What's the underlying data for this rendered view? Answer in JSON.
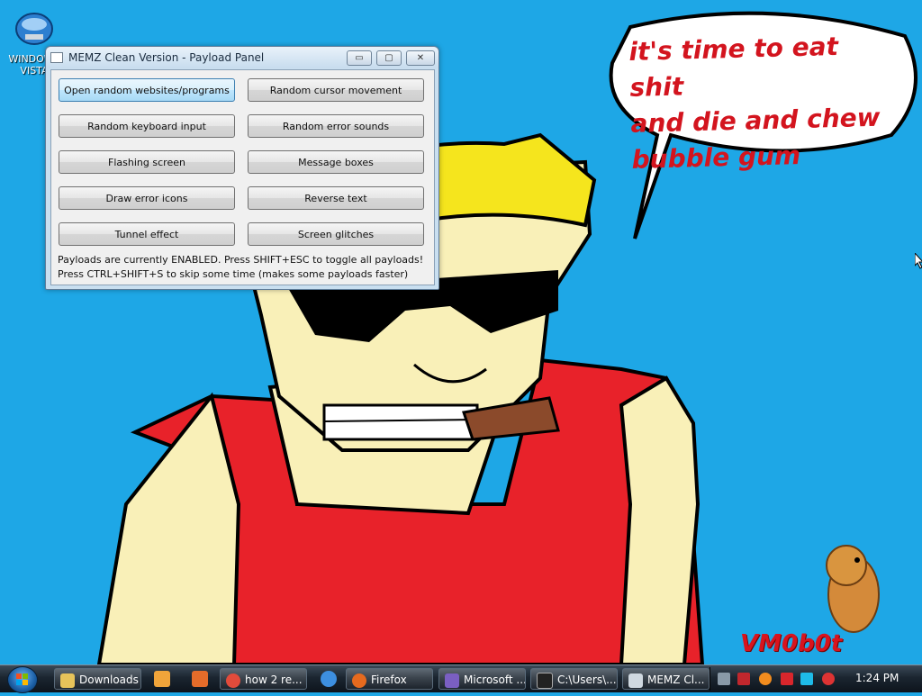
{
  "desktop": {
    "icon_label": "WINDOWS VISTA",
    "speech_lines": [
      "it's time to eat shit",
      "and die and chew",
      "bubble gum"
    ],
    "watermark": "VM0b0t"
  },
  "window": {
    "title": "MEMZ Clean Version - Payload Panel",
    "controls": {
      "minimize": "▭",
      "maximize": "▢",
      "close": "✕"
    },
    "buttons": [
      "Open random websites/programs",
      "Random cursor movement",
      "Random keyboard input",
      "Random error sounds",
      "Flashing screen",
      "Message boxes",
      "Draw error icons",
      "Reverse text",
      "Tunnel effect",
      "Screen glitches"
    ],
    "status_lines": [
      "Payloads are currently ENABLED. Press SHIFT+ESC to toggle all payloads!",
      "Press CTRL+SHIFT+S to skip some time (makes some payloads faster)"
    ]
  },
  "taskbar": {
    "items": [
      {
        "label": "Downloads",
        "icon": "folder-icon",
        "color": "#e7c35a"
      },
      {
        "label": "how 2 re...",
        "icon": "chrome-icon",
        "color": "#e24b3b"
      },
      {
        "label": "Firefox",
        "icon": "firefox-icon",
        "color": "#e66a1e"
      },
      {
        "label": "Microsoft ...",
        "icon": "visual-studio-icon",
        "color": "#7a5fc2"
      },
      {
        "label": "C:\\Users\\...",
        "icon": "console-icon",
        "color": "#222222"
      },
      {
        "label": "MEMZ Cl...",
        "icon": "memz-icon",
        "color": "#cfd8e0"
      }
    ],
    "clock": "1:24 PM"
  },
  "colors": {
    "desktop_bg": "#1ea7e6",
    "speech_text": "#d3141e",
    "shirt": "#e8222a",
    "skin": "#f9f0b8",
    "hair": "#f5e51d"
  }
}
